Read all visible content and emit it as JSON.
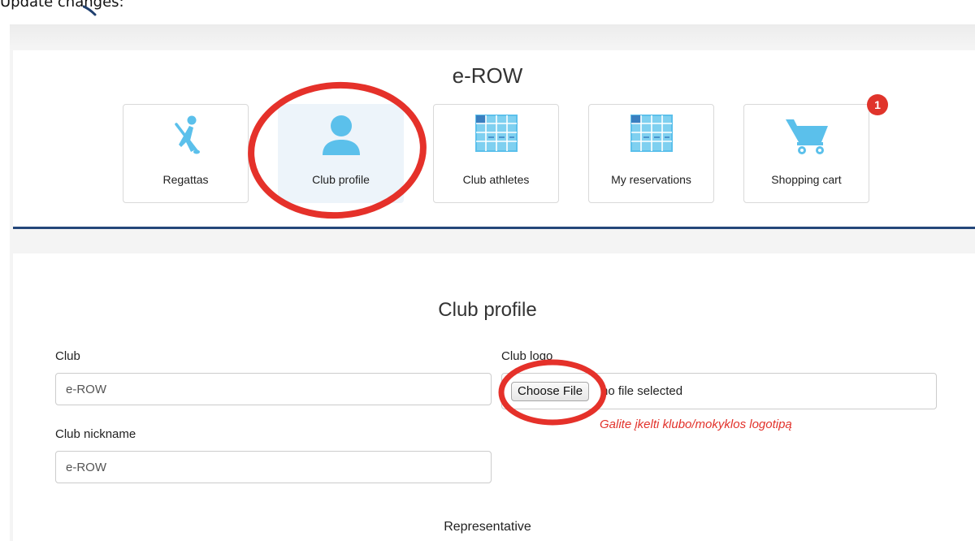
{
  "caption": {
    "text": "Update changes:"
  },
  "header": {
    "title": "e-ROW"
  },
  "nav": {
    "tiles": [
      {
        "label": "Regattas",
        "icon": "rower-icon"
      },
      {
        "label": "Club profile",
        "icon": "user-icon",
        "active": true
      },
      {
        "label": "Club athletes",
        "icon": "table-icon"
      },
      {
        "label": "My reservations",
        "icon": "table-icon"
      },
      {
        "label": "Shopping cart",
        "icon": "cart-icon",
        "badge": "1"
      }
    ]
  },
  "profile": {
    "title": "Club profile",
    "club_label": "Club",
    "club_value": "e-ROW",
    "nickname_label": "Club nickname",
    "nickname_value": "e-ROW",
    "logo_label": "Club logo",
    "choose_file": "Choose File",
    "file_status": "no file selected",
    "logo_hint": "Galite įkelti klubo/mokyklos logotipą",
    "representative_label": "Representative"
  },
  "colors": {
    "accent": "#24477a",
    "icon_blue": "#5bc0eb",
    "badge_red": "#e0342b",
    "highlight_ring": "#e5312a",
    "hint_red": "#e2322b",
    "active_tile_bg": "#edf4fa"
  }
}
